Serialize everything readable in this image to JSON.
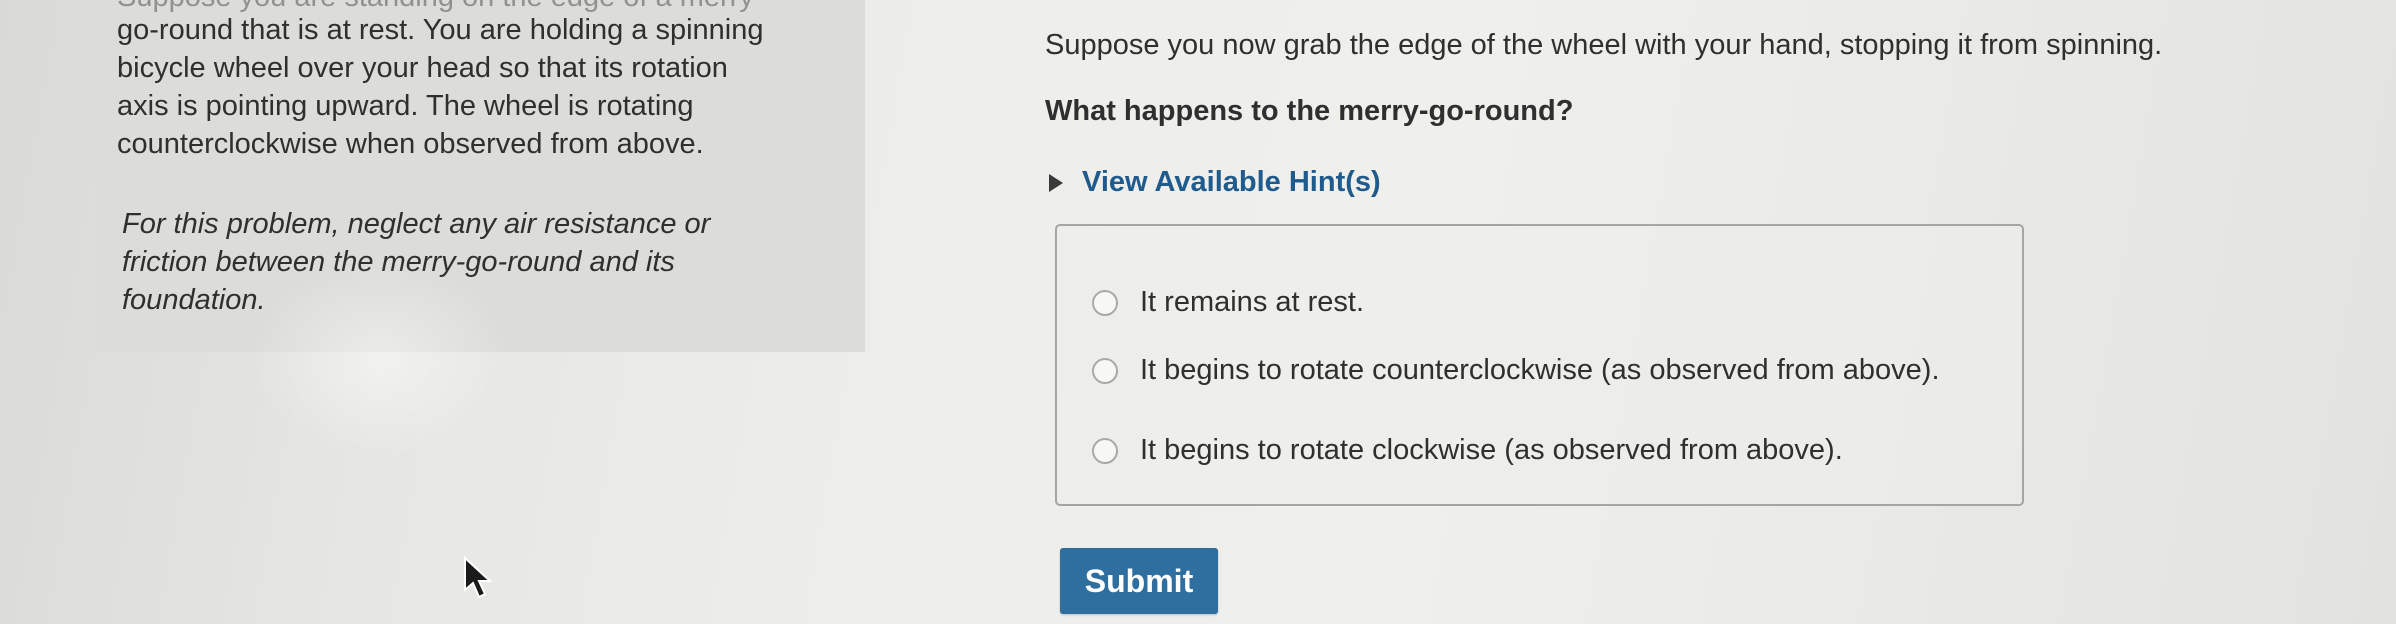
{
  "problem": {
    "cut_line": "Suppose you are standing on the edge of a merry-",
    "lines": [
      "go-round that is at rest. You are holding a spinning",
      "bicycle wheel over your head so that its rotation",
      "axis is pointing upward. The wheel is rotating",
      "counterclockwise when observed from above."
    ],
    "note_lines": [
      "For this problem, neglect any air resistance or",
      "friction between the merry-go-round and its",
      "foundation."
    ]
  },
  "question": {
    "statement": "Suppose you now grab the edge of the wheel with your hand, stopping it from spinning.",
    "ask": "What happens to the merry-go-round?"
  },
  "hints": {
    "label": "View Available Hint(s)",
    "arrow_icon": "triangle-right-icon"
  },
  "options": [
    {
      "label": "It remains at rest."
    },
    {
      "label": "It begins to rotate counterclockwise (as observed from above)."
    },
    {
      "label": "It begins to rotate clockwise (as observed from above)."
    }
  ],
  "submit": {
    "label": "Submit"
  },
  "colors": {
    "accent": "#2f6f9f",
    "hint_text": "#1f5b8c",
    "panel": "#dcdcd8"
  }
}
